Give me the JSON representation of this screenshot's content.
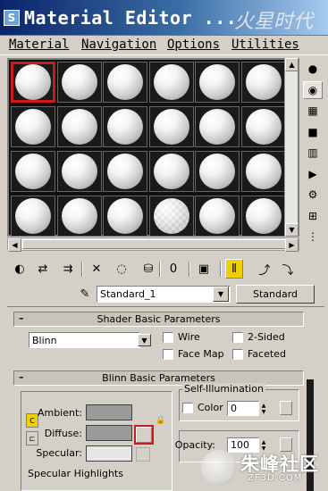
{
  "window": {
    "app_icon": "S",
    "title": "Material Editor ...",
    "watermark_top": "火星时代"
  },
  "menu": [
    {
      "label": "Material"
    },
    {
      "label": "Navigation"
    },
    {
      "label": "Options"
    },
    {
      "label": "Utilities"
    }
  ],
  "slots": {
    "rows": 4,
    "cols": 6,
    "selected_index": 0,
    "checker_index": 21
  },
  "side_toolbar": [
    {
      "icon": "sample-sphere-icon",
      "glyph": "●"
    },
    {
      "icon": "backlight-icon",
      "glyph": "◉"
    },
    {
      "icon": "checker-background-icon",
      "glyph": "▦"
    },
    {
      "icon": "sample-uv-tiling-icon",
      "glyph": "■"
    },
    {
      "icon": "video-color-check-icon",
      "glyph": "▥"
    },
    {
      "icon": "make-preview-icon",
      "glyph": "▶"
    },
    {
      "icon": "options-icon",
      "glyph": "⚙"
    },
    {
      "icon": "select-by-material-icon",
      "glyph": "⊞"
    },
    {
      "icon": "material-map-navigator-icon",
      "glyph": "⋮"
    }
  ],
  "bottom_toolbar": [
    {
      "icon": "get-material-icon",
      "glyph": "◐"
    },
    {
      "icon": "put-to-scene-icon",
      "glyph": "⇄"
    },
    {
      "icon": "assign-to-selection-icon",
      "glyph": "⇉"
    },
    {
      "icon": "reset-map-icon",
      "glyph": "✕"
    },
    {
      "icon": "make-unique-icon",
      "glyph": "◌"
    },
    {
      "icon": "put-to-library-icon",
      "glyph": "⛁"
    },
    {
      "icon": "material-effects-channel-icon",
      "glyph": "0"
    },
    {
      "icon": "show-map-in-viewport-icon",
      "glyph": "▣"
    },
    {
      "icon": "show-end-result-icon",
      "glyph": "⫴"
    },
    {
      "icon": "go-to-parent-icon",
      "glyph": "⤴"
    },
    {
      "icon": "go-forward-to-sibling-icon",
      "glyph": "⤵"
    }
  ],
  "material": {
    "name": "Standard_1",
    "type": "Standard"
  },
  "shader_rollout": {
    "title": "Shader Basic Parameters",
    "shader": "Blinn",
    "checkboxes": [
      {
        "label": "Wire"
      },
      {
        "label": "2-Sided"
      },
      {
        "label": "Face Map"
      },
      {
        "label": "Faceted"
      }
    ]
  },
  "blinn_rollout": {
    "title": "Blinn Basic Parameters",
    "ambient_label": "Ambient:",
    "diffuse_label": "Diffuse:",
    "specular_label": "Specular:",
    "ambient_color": "#9a9a9a",
    "diffuse_color": "#9a9a9a",
    "specular_color": "#e6e6e6",
    "self_illum": {
      "group_label": "Self-Illumination",
      "color_label": "Color",
      "value": "0"
    },
    "opacity": {
      "label": "Opacity:",
      "value": "100"
    },
    "specular_highlights_label": "Specular Highlights"
  },
  "watermark_bottom": {
    "cn": "朱峰社区",
    "en": "ZF3D.COM"
  }
}
